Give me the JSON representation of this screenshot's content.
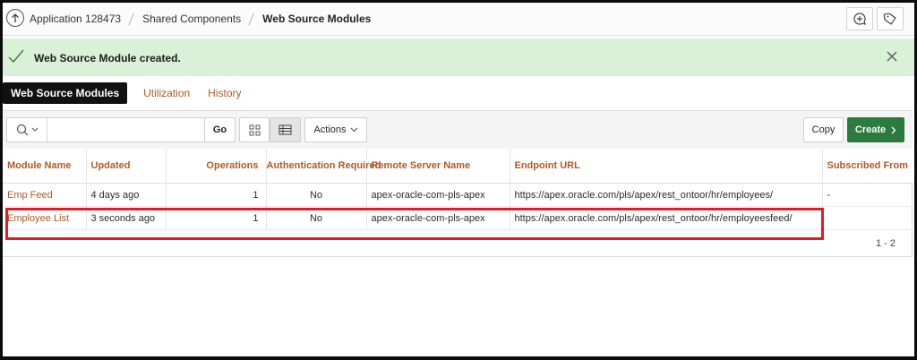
{
  "breadcrumb": {
    "items": [
      "Application 128473",
      "Shared Components"
    ],
    "current": "Web Source Modules"
  },
  "alert": {
    "message": "Web Source Module created."
  },
  "tabs": [
    "Web Source Modules",
    "Utilization",
    "History"
  ],
  "toolbar": {
    "go_label": "Go",
    "actions_label": "Actions",
    "copy_label": "Copy",
    "create_label": "Create"
  },
  "table": {
    "columns": [
      "Module Name",
      "Updated",
      "Operations",
      "Authentication Required",
      "Remote Server Name",
      "Endpoint URL",
      "Subscribed From"
    ],
    "rows": [
      [
        "Emp Feed",
        "4 days ago",
        "1",
        "No",
        "apex-oracle-com-pls-apex",
        "https://apex.oracle.com/pls/apex/rest_ontoor/hr/employees/",
        "-"
      ],
      [
        "Employee List",
        "3 seconds ago",
        "1",
        "No",
        "apex-oracle-com-pls-apex",
        "https://apex.oracle.com/pls/apex/rest_ontoor/hr/employeesfeed/",
        ""
      ]
    ]
  },
  "pagination": "1 - 2",
  "colors": {
    "accent": "#b05a25",
    "success_bg": "#d9f1d7",
    "create_button": "#2b7a3e",
    "highlight": "#e31b23"
  },
  "icons": [
    "up-arrow-icon",
    "add-comment-icon",
    "tag-icon",
    "checkmark-icon",
    "close-icon",
    "search-icon",
    "chevron-down-icon",
    "grid-view-icon",
    "report-view-icon",
    "chevron-right-icon"
  ]
}
